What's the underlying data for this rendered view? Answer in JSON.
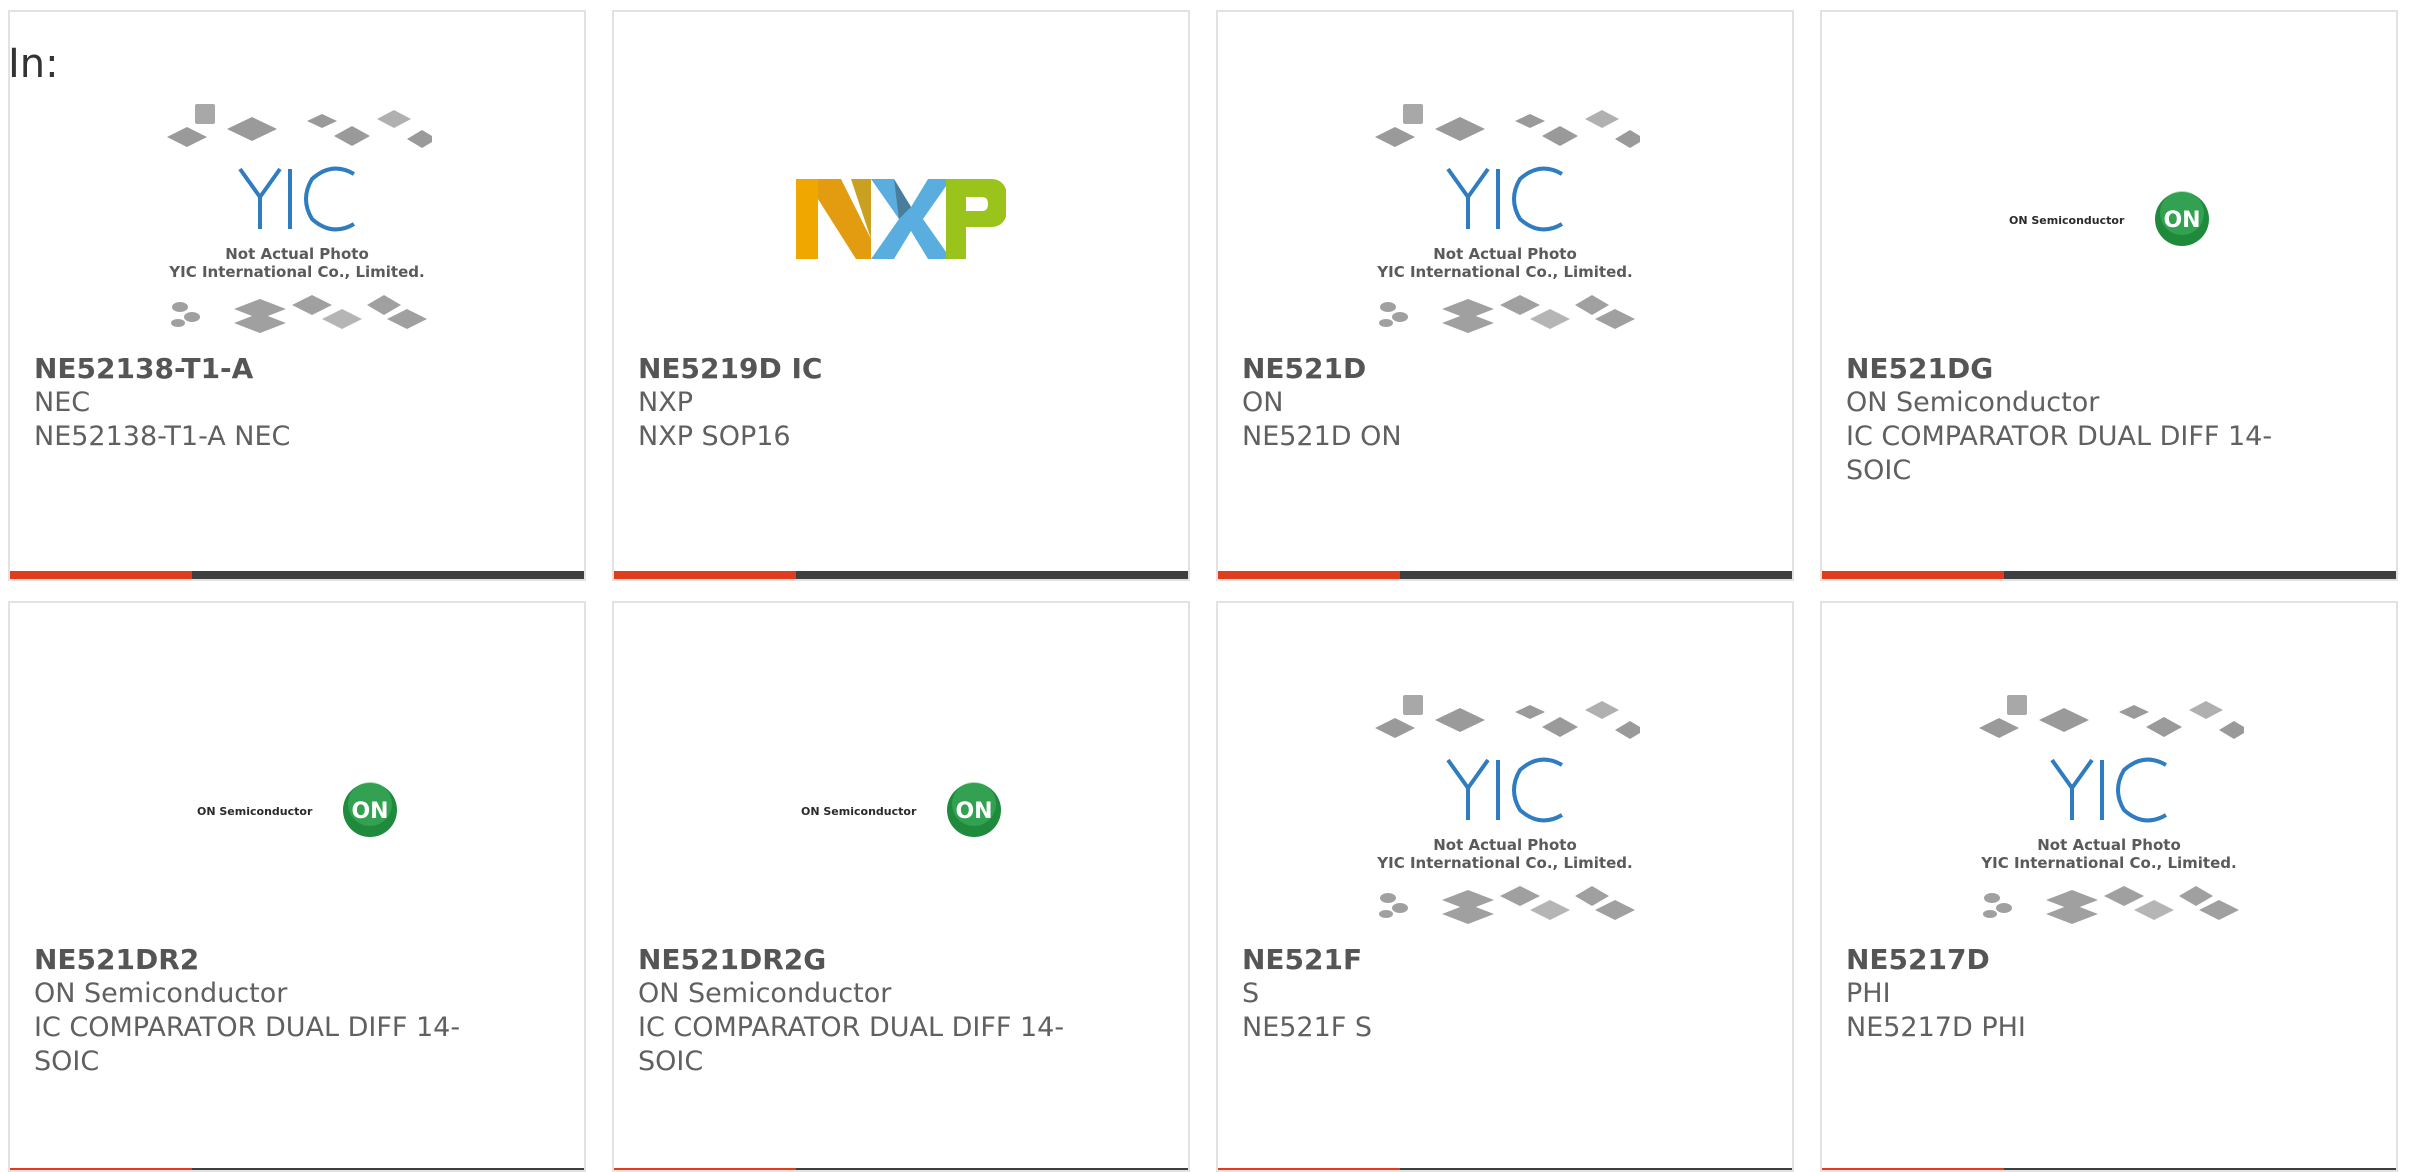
{
  "page": {
    "in_label": "In:"
  },
  "logos": {
    "yic": {
      "icon": "yic-placeholder-logo",
      "line1": "Not Actual Photo",
      "line2": "YIC International Co., Limited."
    },
    "nxp": {
      "icon": "nxp-logo"
    },
    "on": {
      "icon": "on-semiconductor-logo",
      "wordmark": "ON Semiconductor",
      "badge": "ON"
    }
  },
  "colors": {
    "accent": "#e03c1e",
    "bar": "#3f3f3f",
    "text": "#606060",
    "nxp_orange": "#f0a800",
    "nxp_blue": "#5aaedf",
    "nxp_green": "#9ac31c",
    "on_green": "#1f8a3c"
  },
  "products": [
    {
      "part": "NE52138-T1-A",
      "brand": "NEC",
      "desc": "NE52138-T1-A NEC",
      "logo": "yic"
    },
    {
      "part": "NE5219D IC",
      "brand": "NXP",
      "desc": "NXP SOP16",
      "logo": "nxp"
    },
    {
      "part": "NE521D",
      "brand": "ON",
      "desc": "NE521D ON",
      "logo": "yic"
    },
    {
      "part": "NE521DG",
      "brand": "ON Semiconductor",
      "desc": "IC COMPARATOR DUAL DIFF 14-SOIC",
      "logo": "on"
    },
    {
      "part": "NE521DR2",
      "brand": "ON Semiconductor",
      "desc": "IC COMPARATOR DUAL DIFF 14-SOIC",
      "logo": "on"
    },
    {
      "part": "NE521DR2G",
      "brand": "ON Semiconductor",
      "desc": "IC COMPARATOR DUAL DIFF 14-SOIC",
      "logo": "on"
    },
    {
      "part": "NE521F",
      "brand": "S",
      "desc": "NE521F S",
      "logo": "yic"
    },
    {
      "part": "NE5217D",
      "brand": "PHI",
      "desc": "NE5217D PHI",
      "logo": "yic"
    }
  ]
}
